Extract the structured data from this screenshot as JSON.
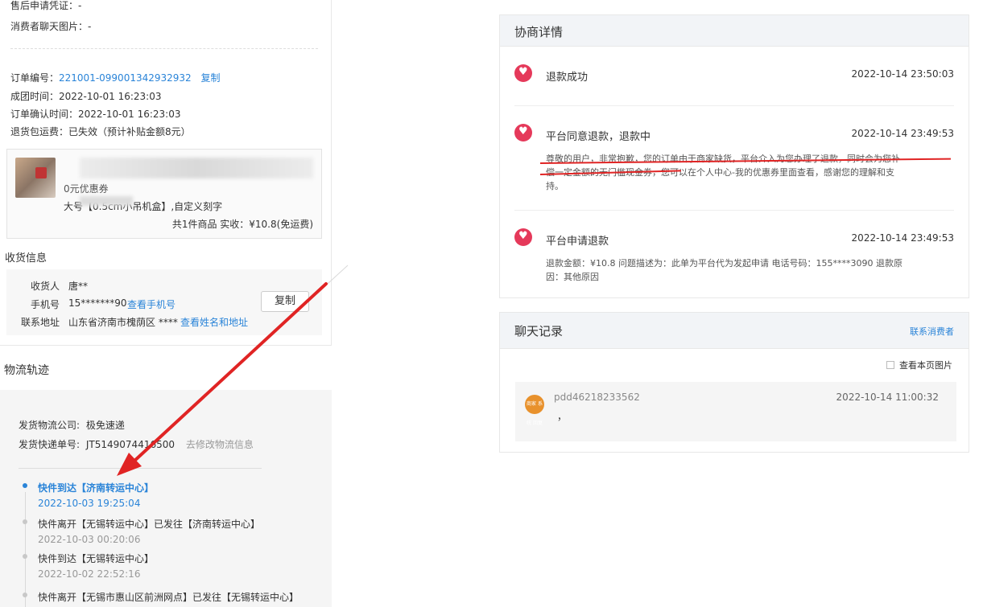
{
  "order": {
    "after_sale_proof_label": "售后申请凭证：",
    "after_sale_proof_value": "-",
    "chat_images_label": "消费者聊天图片：",
    "chat_images_value": "-",
    "order_no_label": "订单编号：",
    "order_no": "221001-099001342932932",
    "copy_link": "复制",
    "group_time_label": "成团时间：",
    "group_time": "2022-10-01 16:23:03",
    "confirm_time_label": "订单确认时间：",
    "confirm_time": "2022-10-01 16:23:03",
    "return_shipping_label": "退货包运费：",
    "return_shipping": "已失效（预计补贴金额8元）"
  },
  "product": {
    "coupon": "0元优惠券",
    "spec": "大号【0.5cm小吊机盒】,自定义刻字",
    "summary": "共1件商品  实收：¥10.8(免运费)"
  },
  "receiver": {
    "section_title": "收货信息",
    "name_label": "收货人",
    "name": "唐**",
    "phone_label": "手机号",
    "phone": "15*******90",
    "view_phone": "查看手机号",
    "address_label": "联系地址",
    "address": "山东省济南市槐荫区 ****",
    "view_address": "查看姓名和地址",
    "copy_button": "复制"
  },
  "logistics": {
    "section_title": "物流轨迹",
    "company_label": "发货物流公司:",
    "company": "极免速递",
    "tracking_label": "发货快递单号:",
    "tracking_no": "JT5149074416500",
    "modify_link": "去修改物流信息",
    "events": [
      {
        "text": "快件到达【济南转运中心】",
        "time": "2022-10-03 19:25:04"
      },
      {
        "text": "快件离开【无锡转运中心】已发往【济南转运中心】",
        "time": "2022-10-03 00:20:06"
      },
      {
        "text": "快件到达【无锡转运中心】",
        "time": "2022-10-02 22:52:16"
      },
      {
        "text": "快件离开【无锡市惠山区前洲网点】已发往【无锡转运中心】",
        "time": ""
      }
    ]
  },
  "negotiation": {
    "title": "协商详情",
    "entries": [
      {
        "title": "退款成功",
        "time": "2022-10-14 23:50:03",
        "body": ""
      },
      {
        "title": "平台同意退款，退款中",
        "time": "2022-10-14 23:49:53",
        "body_line1": "尊敬的用户，非常抱歉，您的订单由于商家缺货，平台介入为您办理了退款，同时会为您补",
        "body_line2": "偿一定金额的无门槛现金券，您可以在个人中心-我的优惠券里面查看，感谢您的理解和支",
        "body_line3": "持。"
      },
      {
        "title": "平台申请退款",
        "time": "2022-10-14 23:49:53",
        "body_line1": "退款金额：¥10.8 问题描述为：此单为平台代为发起申请 电话号码：155****3090 退款原",
        "body_line2": "因：其他原因"
      }
    ]
  },
  "chat": {
    "title": "聊天记录",
    "contact_link": "联系消费者",
    "view_images": "查看本页图片",
    "messages": [
      {
        "user": "pdd46218233562",
        "time": "2022-10-14 11:00:32",
        "text": "，",
        "avatar_text": "商家 系统 回复"
      }
    ]
  },
  "colors": {
    "link": "#2a84d8",
    "accent_red": "#e02424",
    "icon_pink": "#e5395a"
  }
}
